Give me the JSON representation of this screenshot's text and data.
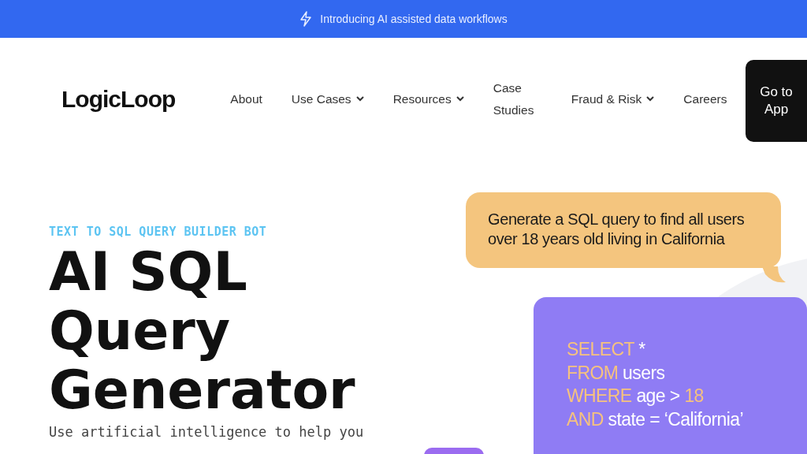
{
  "announcement": {
    "text": "Introducing AI assisted data workflows"
  },
  "nav": {
    "logo": "LogicLoop",
    "items": [
      {
        "label": "About",
        "dropdown": false
      },
      {
        "label": "Use Cases",
        "dropdown": true
      },
      {
        "label": "Resources",
        "dropdown": true
      },
      {
        "label": "Case Studies",
        "dropdown": false
      },
      {
        "label": "Fraud & Risk",
        "dropdown": true
      },
      {
        "label": "Careers",
        "dropdown": false
      }
    ],
    "cta": "Go to App"
  },
  "hero": {
    "eyebrow": "TEXT TO SQL QUERY BUILDER BOT",
    "title": "AI SQL Query Generator",
    "description": "Use artificial intelligence to help you"
  },
  "chat": {
    "prompt": "Generate a SQL query to find all users over 18 years old living in California",
    "code_lines": [
      [
        {
          "text": "SELECT",
          "kind": "keyword"
        },
        {
          "text": " *",
          "kind": "plain"
        }
      ],
      [
        {
          "text": "FROM",
          "kind": "keyword"
        },
        {
          "text": " users",
          "kind": "plain"
        }
      ],
      [
        {
          "text": "WHERE",
          "kind": "keyword"
        },
        {
          "text": " age > ",
          "kind": "plain"
        },
        {
          "text": "18",
          "kind": "number"
        }
      ],
      [
        {
          "text": "AND",
          "kind": "keyword"
        },
        {
          "text": " state = ‘California’",
          "kind": "plain"
        }
      ]
    ]
  }
}
